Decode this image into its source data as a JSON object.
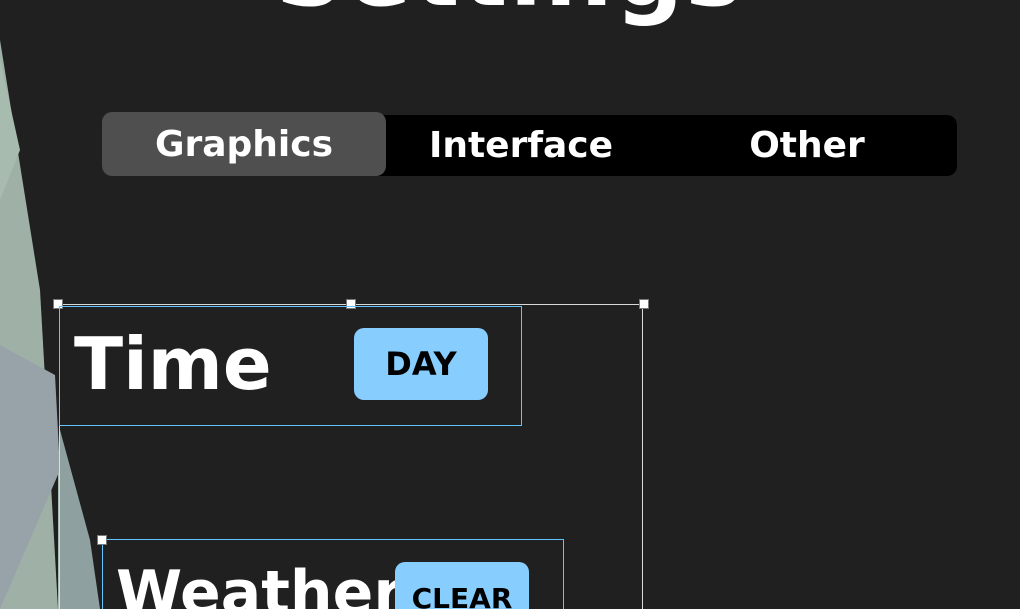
{
  "header": {
    "title": "Settings"
  },
  "tabs": [
    {
      "label": "Graphics",
      "active": true
    },
    {
      "label": "Interface",
      "active": false
    },
    {
      "label": "Other",
      "active": false
    }
  ],
  "settings": [
    {
      "label": "Time",
      "value": "DAY"
    },
    {
      "label": "Weather",
      "value": "CLEAR"
    }
  ],
  "colors": {
    "background": "#202020",
    "tab_bar": "#000000",
    "tab_active": "#4f4f4f",
    "value_button": "#87ceff",
    "selection_frame": "#5fc4ff"
  }
}
